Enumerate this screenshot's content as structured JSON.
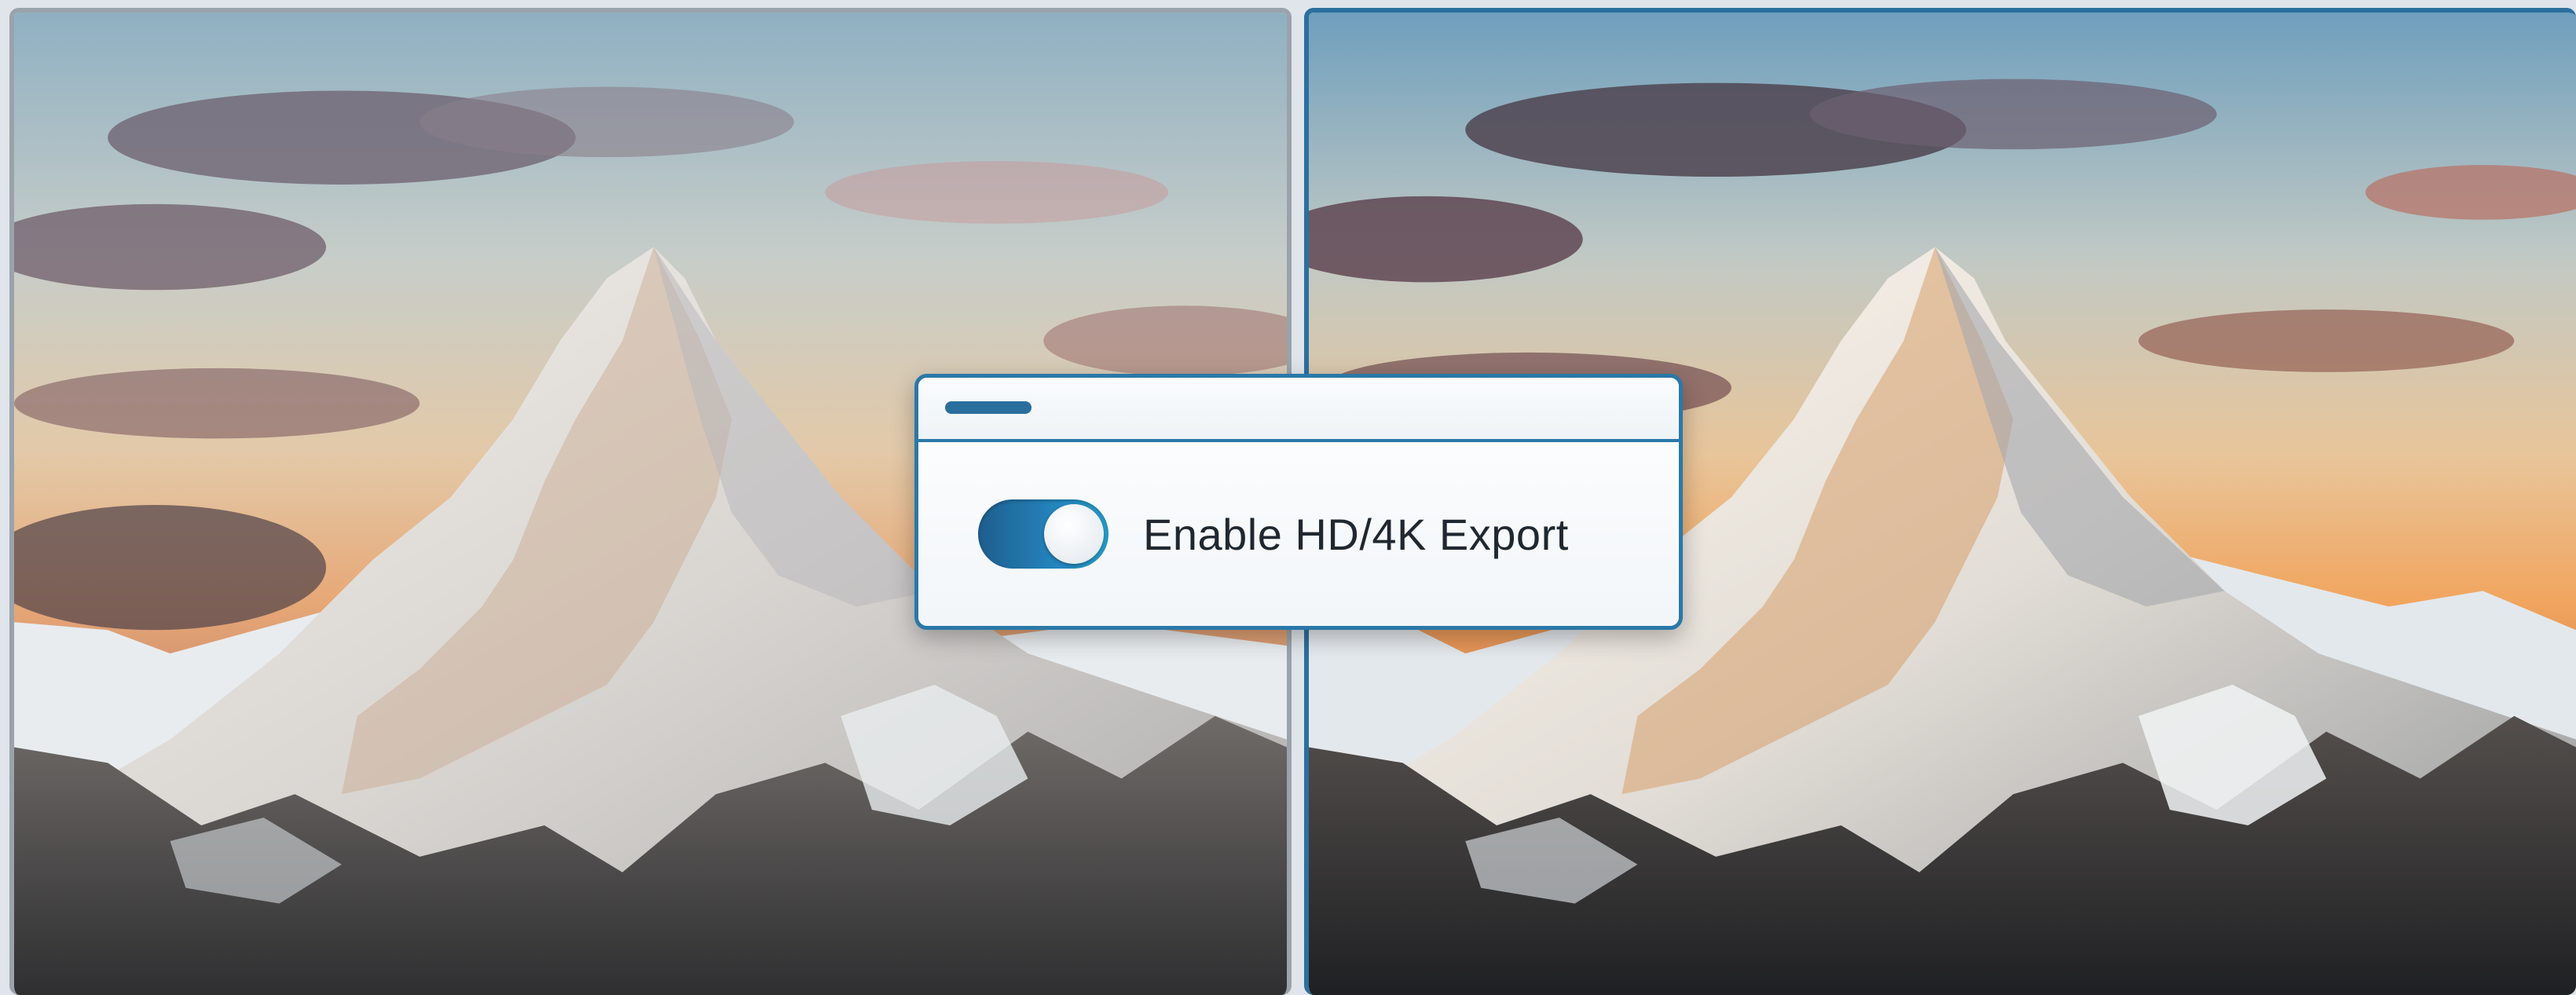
{
  "comparison": {
    "left_image": {
      "description": "mountain-photo-standard",
      "icon": "mountain-image"
    },
    "right_image": {
      "description": "mountain-photo-enhanced",
      "icon": "mountain-image"
    }
  },
  "dialog": {
    "toggle": {
      "label": "Enable HD/4K Export",
      "state": "on"
    }
  },
  "colors": {
    "accent": "#2a78a8",
    "toggle_on": "#2486bf",
    "left_border": "#9aa3ab"
  }
}
